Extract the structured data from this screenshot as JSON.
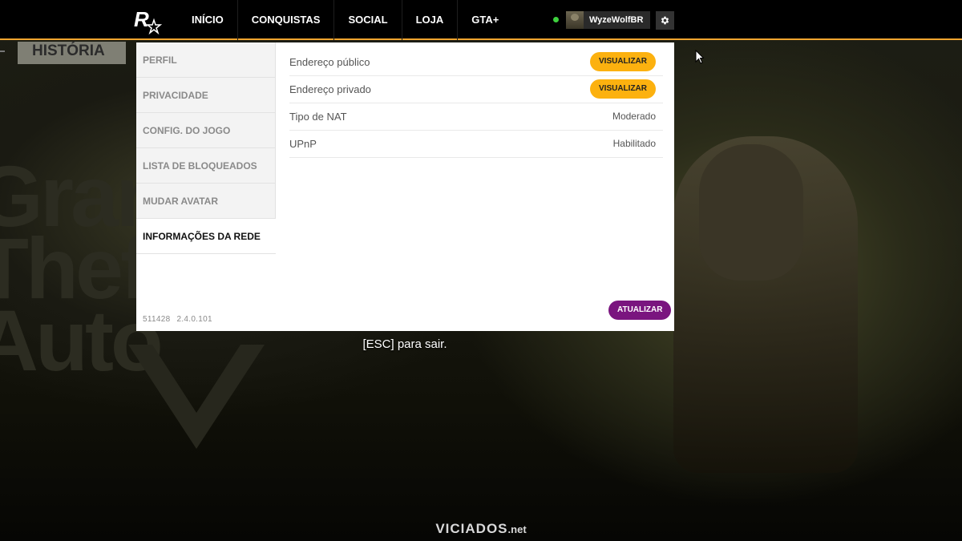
{
  "nav": {
    "items": [
      "INÍCIO",
      "CONQUISTAS",
      "SOCIAL",
      "LOJA",
      "GTA+"
    ],
    "username": "WyzeWolfBR",
    "online_color": "#3ed13e",
    "accent_color": "#f2a52e",
    "logo_icon": "rockstar-logo-icon",
    "settings_icon": "gear-icon"
  },
  "background": {
    "history_tag": "HISTÓRIA"
  },
  "settings": {
    "sidebar": [
      "PERFIL",
      "PRIVACIDADE",
      "CONFIG. DO JOGO",
      "LISTA DE BLOQUEADOS",
      "MUDAR AVATAR",
      "INFORMAÇÕES DA REDE"
    ],
    "active_section": "INFORMAÇÕES DA REDE",
    "version": {
      "build": "511428",
      "number": "2.4.0.101"
    },
    "network": {
      "public_address": {
        "label": "Endereço público",
        "action": "VISUALIZAR"
      },
      "private_address": {
        "label": "Endereço privado",
        "action": "VISUALIZAR"
      },
      "nat_type": {
        "label": "Tipo de NAT",
        "value": "Moderado"
      },
      "upnp": {
        "label": "UPnP",
        "value": "Habilitado"
      }
    },
    "refresh_label": "ATUALIZAR",
    "action_color": "#fcb10f",
    "refresh_color": "#7a157f"
  },
  "footer": {
    "esc_hint": "[ESC] para sair.",
    "watermark": {
      "name": "VICIADOS",
      "tld": ".net"
    }
  }
}
